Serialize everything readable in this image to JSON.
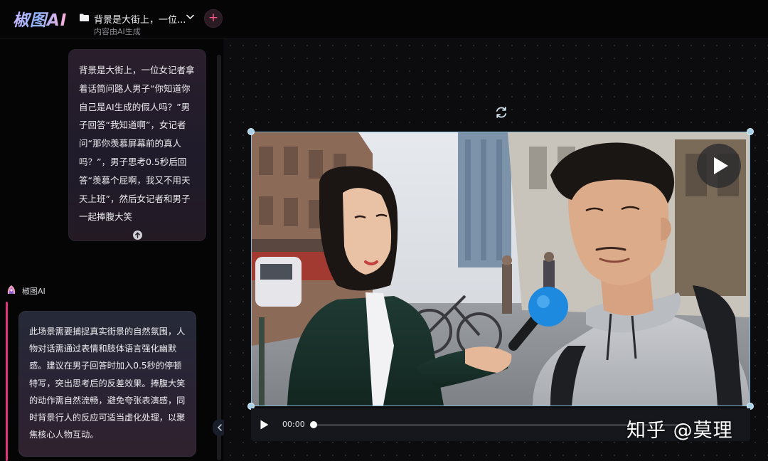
{
  "header": {
    "logo": "椒图AI",
    "project_title": "背景是大街上，一位...",
    "project_subtitle": "内容由AI生成",
    "add_label": "+"
  },
  "chat": {
    "user_message": "背景是大街上，一位女记者拿着话筒问路人男子“你知道你自己是AI生成的假人吗？”男子回答“我知道啊”，女记者问“那你羡慕屏幕前的真人吗？”，男子思考0.5秒后回答“羡慕个屁啊，我又不用天天上班”，然后女记者和男子一起捧腹大笑",
    "bot_name": "椒图AI",
    "bot_message": "此场景需要捕捉真实街景的自然氛围，人物对话需通过表情和肢体语言强化幽默感。建议在男子回答时加入0.5秒的停顿特写，突出思考后的反差效果。捧腹大笑的动作需自然流畅，避免夸张表演感，同时背景行人的反应可适当虚化处理，以聚焦核心人物互动。"
  },
  "player": {
    "time": "00:00",
    "progress": 0.0
  },
  "watermark": "知乎 @莫理",
  "colors": {
    "accent": "#e0357a",
    "selection": "#7eb7d8"
  }
}
